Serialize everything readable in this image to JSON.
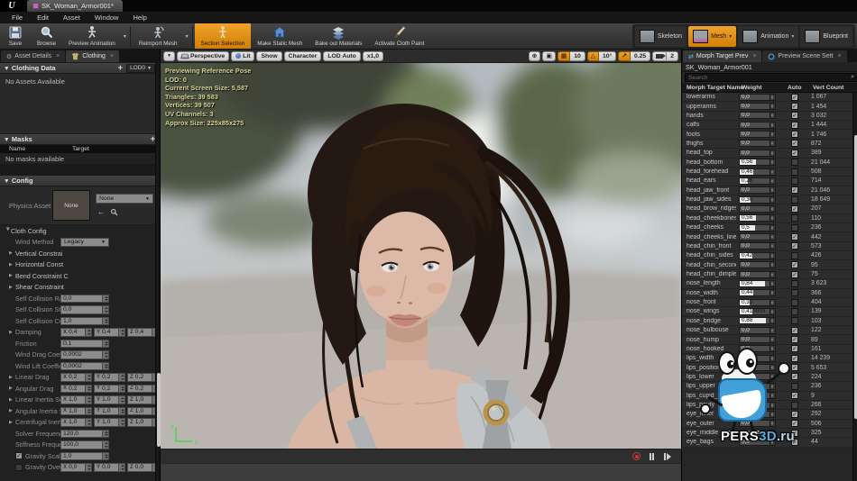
{
  "window": {
    "logo": "U",
    "doc_tab": "SK_Woman_Armor001*"
  },
  "menu": [
    "File",
    "Edit",
    "Asset",
    "Window",
    "Help"
  ],
  "toolbar": {
    "buttons": [
      {
        "label": "Save"
      },
      {
        "label": "Browse"
      },
      {
        "label": "Preview Animation"
      },
      {
        "label": "Reimport Mesh"
      },
      {
        "label": "Section Selection"
      },
      {
        "label": "Make Static Mesh"
      },
      {
        "label": "Bake out Materials"
      },
      {
        "label": "Activate Cloth Paint"
      }
    ]
  },
  "mode_tabs": [
    {
      "label": "Skeleton"
    },
    {
      "label": "Mesh"
    },
    {
      "label": "Animation"
    },
    {
      "label": "Blueprint"
    }
  ],
  "left_panel": {
    "tabs": [
      {
        "label": "Asset Details"
      },
      {
        "label": "Clothing"
      }
    ],
    "clothing_data": {
      "title": "Clothing Data",
      "lod_button": "LOD0",
      "empty_text": "No Assets Available"
    },
    "masks": {
      "title": "Masks",
      "name_col": "Name",
      "target_col": "Target",
      "empty_text": "No masks available"
    },
    "config": {
      "title": "Config",
      "physics_asset_label": "Physics Asset",
      "physics_asset_thumb": "None",
      "physics_asset_value": "None",
      "rows": [
        {
          "type": "grp arr open i0",
          "label": "Cloth Config"
        },
        {
          "type": "sel i1",
          "label": "Wind Method",
          "value": "Legacy"
        },
        {
          "type": "grp arr i1",
          "label": "Vertical Constrai"
        },
        {
          "type": "grp arr i1",
          "label": "Horizontal Const"
        },
        {
          "type": "grp arr i1",
          "label": "Bend Constraint C"
        },
        {
          "type": "grp arr i1",
          "label": "Shear Constraint"
        },
        {
          "type": "num i1",
          "label": "Self Collision Rad",
          "value": "0,0"
        },
        {
          "type": "num i1",
          "label": "Self Collision Stif",
          "value": "0,0"
        },
        {
          "type": "num i1",
          "label": "Self Collision Cull",
          "value": "1,0"
        },
        {
          "type": "xyz arr i1",
          "label": "Damping",
          "x": "0,4",
          "y": "0,4",
          "z": "0,4"
        },
        {
          "type": "num i1",
          "label": "Friction",
          "value": "0,1"
        },
        {
          "type": "num i1",
          "label": "Wind Drag Coeffic",
          "value": "0,0002"
        },
        {
          "type": "num i1",
          "label": "Wind Lift Coeffici",
          "value": "0,0002"
        },
        {
          "type": "xyz arr i1",
          "label": "Linear Drag",
          "x": "0,2",
          "y": "0,2",
          "z": "0,2"
        },
        {
          "type": "xyz arr i1",
          "label": "Angular Drag",
          "x": "0,2",
          "y": "0,2",
          "z": "0,2"
        },
        {
          "type": "xyz arr i1",
          "label": "Linear Inertia Sca",
          "x": "1,0",
          "y": "1,0",
          "z": "1,0"
        },
        {
          "type": "xyz arr i1",
          "label": "Angular Inertia S",
          "x": "1,0",
          "y": "1,0",
          "z": "1,0"
        },
        {
          "type": "xyz arr i1",
          "label": "Centrifugal Inerti",
          "x": "1,0",
          "y": "1,0",
          "z": "1,0"
        },
        {
          "type": "num i1",
          "label": "Solver Frequency",
          "value": "120,0"
        },
        {
          "type": "num i1",
          "label": "Stiffness Frequen",
          "value": "100,0"
        },
        {
          "type": "num chk on i1",
          "label": "Gravity Scale",
          "value": "1,0"
        },
        {
          "type": "xyz chk i1",
          "label": "Gravity Overr",
          "x": "0,0",
          "y": "0,0",
          "z": "0,0"
        }
      ]
    }
  },
  "viewport": {
    "buttons": {
      "perspective": "Perspective",
      "lit": "Lit",
      "show": "Show",
      "character": "Character",
      "lod": "LOD Auto",
      "speed": "x1,0"
    },
    "snap": {
      "grid": "10",
      "angle": "10°",
      "scale": "0.25",
      "camera_speed": "2"
    },
    "stats": [
      "Previewing Reference Pose",
      "LOD: 0",
      "Current Screen Size: 5,587",
      "Triangles: 39 583",
      "Vertices: 39 507",
      "UV Channels: 3",
      "Approx Size: 225x85x275"
    ],
    "gizmo": {
      "z": "z",
      "y": "y"
    }
  },
  "right_panel": {
    "tabs": [
      {
        "label": "Morph Target Prev"
      },
      {
        "label": "Preview Scene Sett"
      }
    ],
    "asset_name": "SK_Woman_Armor001",
    "search_placeholder": "Search",
    "columns": [
      "Morph Target Name",
      "Weight",
      "Auto",
      "Vert Count"
    ],
    "morphs": [
      {
        "name": "lowerarms",
        "weight": "0,0",
        "w": 0,
        "auto": true,
        "verts": "1 067"
      },
      {
        "name": "upperarms",
        "weight": "0,0",
        "w": 0,
        "auto": true,
        "verts": "1 454"
      },
      {
        "name": "hands",
        "weight": "0,0",
        "w": 0,
        "auto": true,
        "verts": "3 032"
      },
      {
        "name": "calfs",
        "weight": "0,0",
        "w": 0,
        "auto": true,
        "verts": "1 444"
      },
      {
        "name": "foots",
        "weight": "0,0",
        "w": 0,
        "auto": true,
        "verts": "1 746"
      },
      {
        "name": "thighs",
        "weight": "0,0",
        "w": 0,
        "auto": true,
        "verts": "872"
      },
      {
        "name": "head_top",
        "weight": "0,0",
        "w": 0,
        "auto": true,
        "verts": "389"
      },
      {
        "name": "head_bottom",
        "weight": "0,56",
        "w": 0.56,
        "auto": false,
        "verts": "21 044"
      },
      {
        "name": "head_forehead",
        "weight": "0,46",
        "w": 0.46,
        "auto": false,
        "verts": "508"
      },
      {
        "name": "head_ears",
        "weight": "0,26",
        "w": 0.26,
        "auto": false,
        "verts": "714"
      },
      {
        "name": "head_jaw_front",
        "weight": "0,0",
        "w": 0,
        "auto": true,
        "verts": "21 046"
      },
      {
        "name": "head_jaw_sides",
        "weight": "0,36",
        "w": 0.36,
        "auto": false,
        "verts": "18 649"
      },
      {
        "name": "head_brow_ridges",
        "weight": "0,0",
        "w": 0,
        "auto": true,
        "verts": "207"
      },
      {
        "name": "head_cheekbones",
        "weight": "0,56",
        "w": 0.56,
        "auto": false,
        "verts": "110"
      },
      {
        "name": "head_cheeks",
        "weight": "0,5",
        "w": 0.5,
        "auto": false,
        "verts": "236"
      },
      {
        "name": "head_cheeks_lines",
        "weight": "0,0",
        "w": 0,
        "auto": true,
        "verts": "442"
      },
      {
        "name": "head_chin_front",
        "weight": "0,0",
        "w": 0,
        "auto": true,
        "verts": "573"
      },
      {
        "name": "head_chin_sides",
        "weight": "0,42",
        "w": 0.42,
        "auto": false,
        "verts": "426"
      },
      {
        "name": "head_chin_second",
        "weight": "0,0",
        "w": 0,
        "auto": true,
        "verts": "95"
      },
      {
        "name": "head_chin_dimple",
        "weight": "0,0",
        "w": 0,
        "auto": true,
        "verts": "75"
      },
      {
        "name": "nose_length",
        "weight": "0,84",
        "w": 0.84,
        "auto": false,
        "verts": "3 623"
      },
      {
        "name": "nose_width",
        "weight": "0,44",
        "w": 0.44,
        "auto": false,
        "verts": "366"
      },
      {
        "name": "nose_front",
        "weight": "0,32",
        "w": 0.32,
        "auto": false,
        "verts": "404"
      },
      {
        "name": "nose_wings",
        "weight": "0,419999",
        "w": 0.42,
        "auto": false,
        "verts": "139"
      },
      {
        "name": "nose_bridge",
        "weight": "0,88",
        "w": 0.88,
        "auto": false,
        "verts": "103"
      },
      {
        "name": "nose_bulbouse",
        "weight": "0,0",
        "w": 0,
        "auto": true,
        "verts": "122"
      },
      {
        "name": "nose_hump",
        "weight": "0,0",
        "w": 0,
        "auto": true,
        "verts": "89"
      },
      {
        "name": "nose_hooked",
        "weight": "0,0",
        "w": 0,
        "auto": true,
        "verts": "161"
      },
      {
        "name": "lips_width",
        "weight": "0,0",
        "w": 0,
        "auto": true,
        "verts": "14 239"
      },
      {
        "name": "lips_position",
        "weight": "0,0",
        "w": 0,
        "auto": true,
        "verts": "5 653"
      },
      {
        "name": "lips_lower",
        "weight": "0,0",
        "w": 0,
        "auto": true,
        "verts": "224"
      },
      {
        "name": "lips_upper",
        "weight": "0,0",
        "w": 0,
        "auto": false,
        "verts": "236"
      },
      {
        "name": "lips_cupid_bow",
        "weight": "0,0",
        "w": 0,
        "auto": true,
        "verts": "9"
      },
      {
        "name": "lips_pouty",
        "weight": "0,26",
        "w": 0.26,
        "auto": false,
        "verts": "266"
      },
      {
        "name": "eye_inner",
        "weight": "0,0",
        "w": 0,
        "auto": true,
        "verts": "292"
      },
      {
        "name": "eye_outer",
        "weight": "0,0",
        "w": 0,
        "auto": true,
        "verts": "506"
      },
      {
        "name": "eye_middle",
        "weight": "0,0",
        "w": 0,
        "auto": true,
        "verts": "325"
      },
      {
        "name": "eye_bags",
        "weight": "0,0",
        "w": 0,
        "auto": true,
        "verts": "44"
      }
    ]
  },
  "watermark": {
    "pers": "PERS",
    "threed": "3D",
    "ru": ".ru"
  },
  "colors": {
    "accent_orange": "#e0890f",
    "slider_fill": "#ebebeb",
    "stats_text": "#d9d194"
  }
}
